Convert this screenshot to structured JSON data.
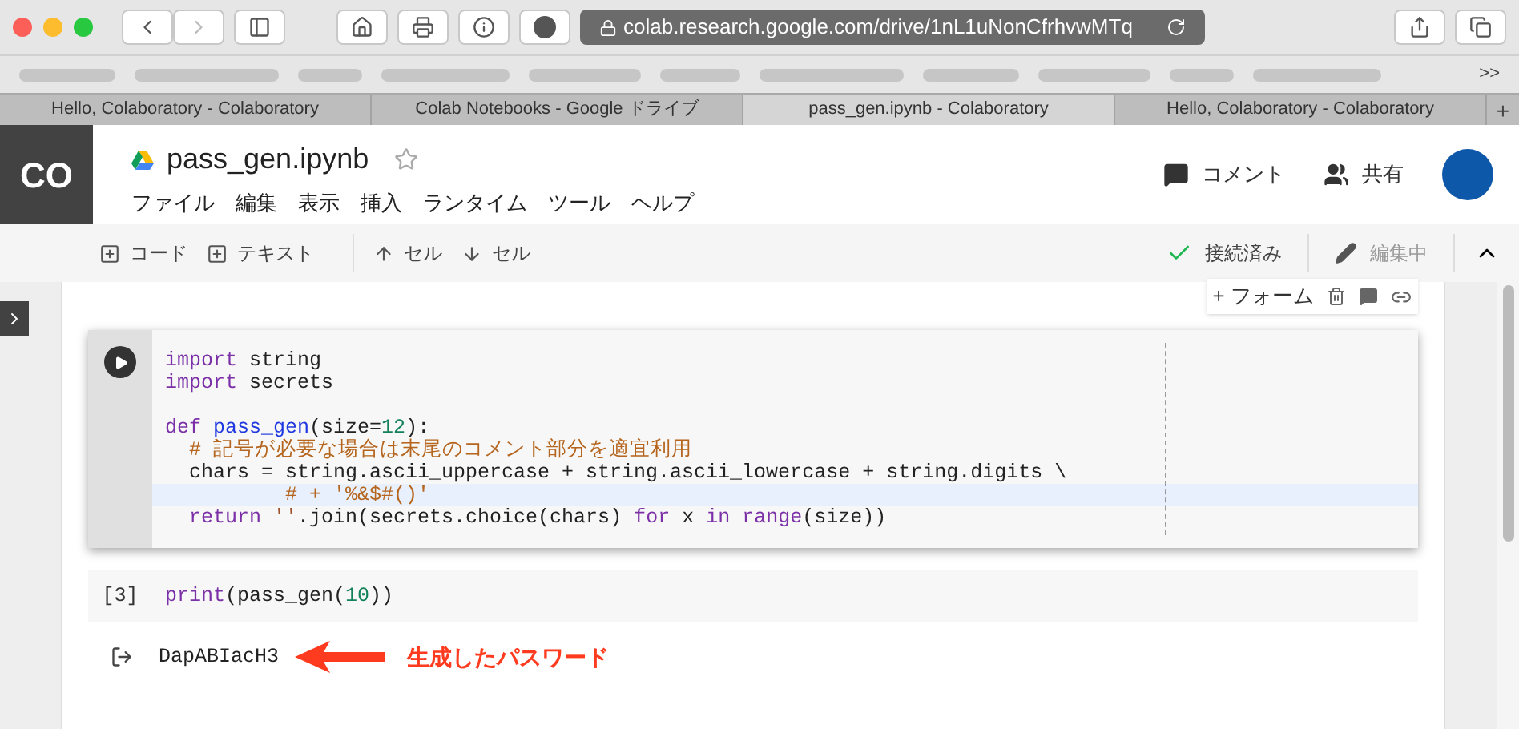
{
  "browser": {
    "url": "colab.research.google.com/drive/1nL1uNonCfrhvwMTq",
    "tabs": [
      {
        "label": "Hello, Colaboratory - Colaboratory",
        "selected": false
      },
      {
        "label": "Colab Notebooks - Google ドライブ",
        "selected": false
      },
      {
        "label": "pass_gen.ipynb - Colaboratory",
        "selected": true
      },
      {
        "label": "Hello, Colaboratory - Colaboratory",
        "selected": false
      }
    ],
    "new_tab": "+",
    "bookmarks_more": ">>"
  },
  "header": {
    "logo": "CO",
    "title": "pass_gen.ipynb",
    "starred": false,
    "menu": [
      "ファイル",
      "編集",
      "表示",
      "挿入",
      "ランタイム",
      "ツール",
      "ヘルプ"
    ],
    "comment": "コメント",
    "share": "共有"
  },
  "toolbar": {
    "left": [
      {
        "kind": "add",
        "label": "コード"
      },
      {
        "kind": "add",
        "label": "テキスト"
      },
      {
        "kind": "up",
        "label": "セル"
      },
      {
        "kind": "down",
        "label": "セル"
      }
    ],
    "status": "接続済み",
    "editing": "編集中"
  },
  "cell_toolbar": {
    "form": "+ フォーム"
  },
  "cells": [
    {
      "kind": "code",
      "focused": true,
      "lines": [
        {
          "highlighted": false,
          "tokens": [
            {
              "t": "import",
              "kind": "kw"
            },
            {
              "t": " string",
              "kind": "plain"
            }
          ]
        },
        {
          "highlighted": false,
          "tokens": [
            {
              "t": "import",
              "kind": "kw"
            },
            {
              "t": " secrets",
              "kind": "plain"
            }
          ]
        },
        {
          "highlighted": false
        },
        {
          "highlighted": false,
          "tokens": [
            {
              "t": "def",
              "kind": "kw"
            },
            {
              "t": " pass_gen",
              "kind": "fn"
            },
            {
              "t": "(size=",
              "kind": "plain"
            },
            {
              "t": "12",
              "kind": "num"
            },
            {
              "t": "):",
              "kind": "plain"
            }
          ]
        },
        {
          "highlighted": false,
          "tokens": [
            {
              "t": "  # 記号が必要な場合は末尾のコメント部分を適宜利用",
              "kind": "cm"
            }
          ]
        },
        {
          "highlighted": false,
          "tokens": [
            {
              "t": "  chars = string.ascii_uppercase + string.ascii_lowercase + string.digits \\",
              "kind": "plain"
            }
          ]
        },
        {
          "highlighted": true,
          "tokens": [
            {
              "t": "          # + '%&$#()'",
              "kind": "cm"
            }
          ]
        },
        {
          "highlighted": false,
          "tokens": [
            {
              "t": "  return",
              "kind": "kw"
            },
            {
              "t": " ''",
              "kind": "str"
            },
            {
              "t": ".join(secrets.choice(chars) ",
              "kind": "plain"
            },
            {
              "t": "for",
              "kind": "kw"
            },
            {
              "t": " x ",
              "kind": "plain"
            },
            {
              "t": "in",
              "kind": "kw"
            },
            {
              "t": " range",
              "kind": "kw"
            },
            {
              "t": "(size))",
              "kind": "plain"
            }
          ]
        }
      ]
    },
    {
      "kind": "code",
      "focused": false,
      "count": "[3]",
      "lines": [
        {
          "highlighted": false,
          "tokens": [
            {
              "t": "print",
              "kind": "kw"
            },
            {
              "t": "(pass_gen(",
              "kind": "plain"
            },
            {
              "t": "10",
              "kind": "num"
            },
            {
              "t": "))",
              "kind": "plain"
            }
          ]
        }
      ],
      "output": "DapABIacH3"
    }
  ],
  "annotation": "生成したパスワード"
}
